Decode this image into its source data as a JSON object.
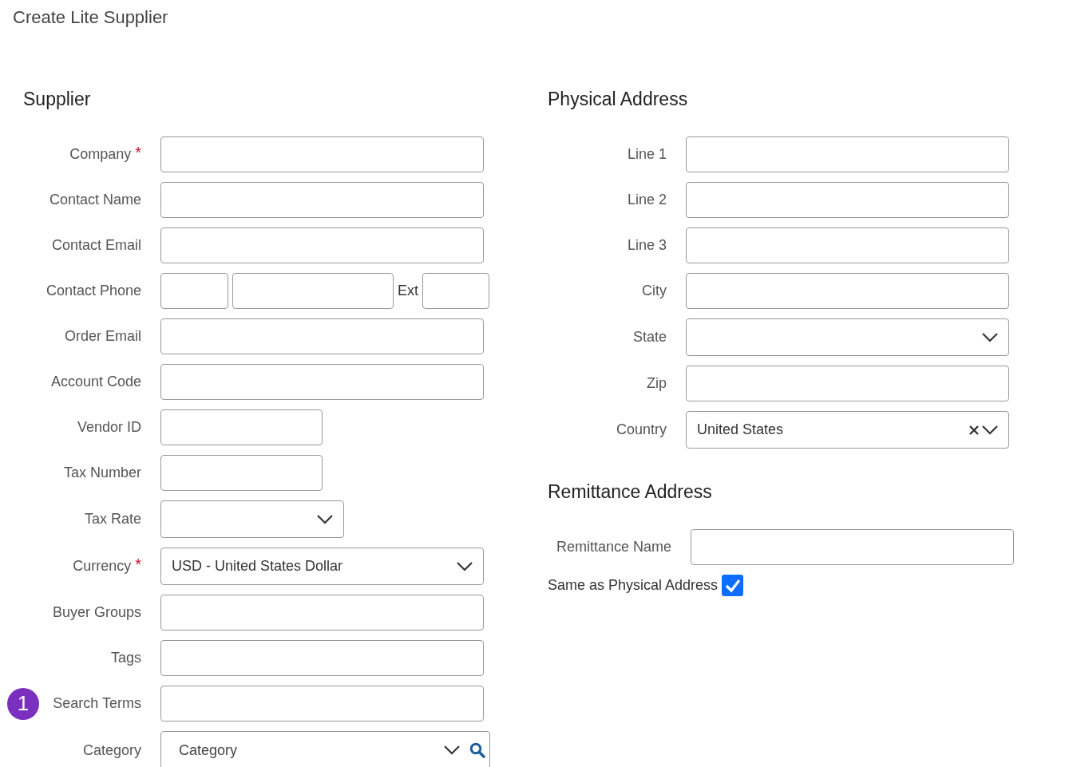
{
  "page_title": "Create Lite Supplier",
  "supplier": {
    "heading": "Supplier",
    "required_mark": "*",
    "fields": [
      {
        "label": "Company",
        "required": true,
        "kind": "text"
      },
      {
        "label": "Contact Name",
        "required": false,
        "kind": "text"
      },
      {
        "label": "Contact Email",
        "required": false,
        "kind": "text"
      },
      {
        "label": "Contact Phone",
        "required": false,
        "kind": "phone",
        "ext_label": "Ext"
      },
      {
        "label": "Order Email",
        "required": false,
        "kind": "text"
      },
      {
        "label": "Account Code",
        "required": false,
        "kind": "text"
      },
      {
        "label": "Vendor ID",
        "required": false,
        "kind": "short-text"
      },
      {
        "label": "Tax Number",
        "required": false,
        "kind": "short-text"
      },
      {
        "label": "Tax Rate",
        "required": false,
        "kind": "short-select"
      },
      {
        "label": "Currency",
        "required": true,
        "kind": "select",
        "value": "USD - United States Dollar"
      },
      {
        "label": "Buyer Groups",
        "required": false,
        "kind": "text"
      },
      {
        "label": "Tags",
        "required": false,
        "kind": "text"
      },
      {
        "label": "Search Terms",
        "required": false,
        "kind": "text",
        "marker": "1"
      },
      {
        "label": "Category",
        "required": false,
        "kind": "category",
        "placeholder": "Category"
      }
    ]
  },
  "physical_address": {
    "heading": "Physical Address",
    "fields": [
      {
        "label": "Line 1",
        "kind": "text"
      },
      {
        "label": "Line 2",
        "kind": "text"
      },
      {
        "label": "Line 3",
        "kind": "text"
      },
      {
        "label": "City",
        "kind": "text"
      },
      {
        "label": "State",
        "kind": "select"
      },
      {
        "label": "Zip",
        "kind": "text"
      },
      {
        "label": "Country",
        "kind": "select",
        "value": "United States",
        "clearable": true
      }
    ]
  },
  "remittance_address": {
    "heading": "Remittance Address",
    "name_label": "Remittance Name",
    "same_as_label": "Same as Physical Address",
    "same_as_checked": true
  }
}
